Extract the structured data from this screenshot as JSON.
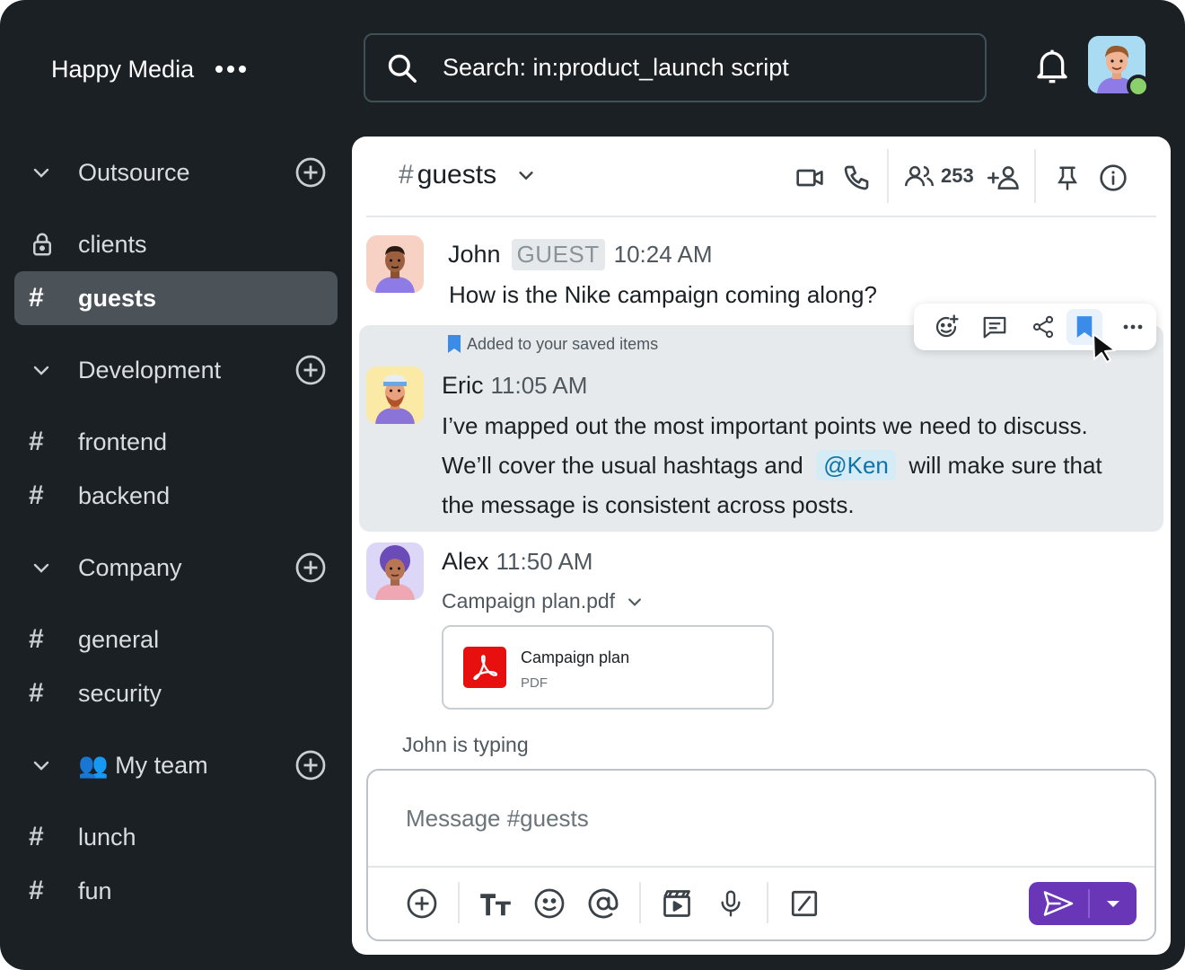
{
  "workspace": {
    "name": "Happy Media",
    "menu_icon": "more-horizontal-icon"
  },
  "search": {
    "value": "Search: in:product_launch script",
    "placeholder": "Search"
  },
  "sidebar": {
    "sections": [
      {
        "label": "Outsource"
      },
      {
        "label": "Development"
      },
      {
        "label": "Company"
      },
      {
        "label": "My team",
        "emoji": "👥"
      }
    ],
    "channels": [
      {
        "label": "clients",
        "icon": "lock-icon"
      },
      {
        "label": "guests",
        "icon": "hash-icon",
        "active": true
      },
      {
        "label": "frontend",
        "icon": "hash-icon"
      },
      {
        "label": "backend",
        "icon": "hash-icon"
      },
      {
        "label": "general",
        "icon": "hash-icon"
      },
      {
        "label": "security",
        "icon": "hash-icon"
      },
      {
        "label": "lunch",
        "icon": "hash-icon"
      },
      {
        "label": "fun",
        "icon": "hash-icon"
      }
    ],
    "hash": "#"
  },
  "channel": {
    "hash": "#",
    "name": "guests",
    "member_count": "253"
  },
  "messages": [
    {
      "author": "John",
      "badge": "GUEST",
      "time": "10:24 AM",
      "text": "How is the Nike campaign coming along?"
    },
    {
      "author": "Eric",
      "time": "11:05 AM",
      "saved_note": "Added to your saved items",
      "line1": "I’ve mapped out the most important points we need to discuss.",
      "line2_before": "We’ll cover the usual hashtags and",
      "mention": "@Ken",
      "line2_after": "will make sure that",
      "line3": "the message is consistent across posts."
    },
    {
      "author": "Alex",
      "time": "11:50 AM",
      "file_link": "Campaign plan.pdf",
      "file_title": "Campaign plan",
      "file_type": "PDF"
    }
  ],
  "typing": "John is typing",
  "composer": {
    "placeholder": "Message #guests"
  },
  "colors": {
    "accent": "#6a36b8",
    "saved": "#3b8be8",
    "mention_bg": "#d5ecf6",
    "online": "#8ad06b",
    "pdf": "#e8100f"
  }
}
